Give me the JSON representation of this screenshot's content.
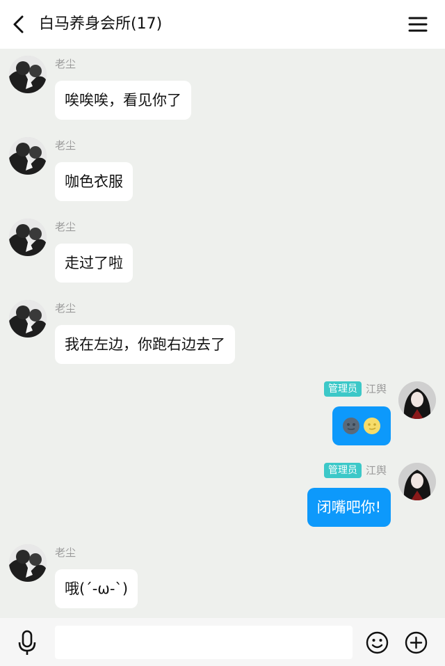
{
  "header": {
    "title": "白马养身会所(17)"
  },
  "messages": [
    {
      "side": "left",
      "sender": "老尘",
      "text": "唉唉唉，看见你了"
    },
    {
      "side": "left",
      "sender": "老尘",
      "text": "咖色衣服"
    },
    {
      "side": "left",
      "sender": "老尘",
      "text": "走过了啦"
    },
    {
      "side": "left",
      "sender": "老尘",
      "text": "我在左边，你跑右边去了"
    },
    {
      "side": "right",
      "badge": "管理员",
      "sender": "江舆",
      "content": "moon-emoji-pair"
    },
    {
      "side": "right",
      "badge": "管理员",
      "sender": "江舆",
      "text": "闭嘴吧你!"
    },
    {
      "side": "left",
      "sender": "老尘",
      "text": "哦(´-ω-`)"
    }
  ],
  "colors": {
    "outgoing_bubble": "#0d99fb",
    "incoming_bubble": "#ffffff",
    "badge": "#3cc8c8",
    "chat_bg": "#eef0ed"
  },
  "icons": [
    "back-icon",
    "menu-icon",
    "microphone-icon",
    "emoji-icon",
    "plus-icon"
  ]
}
